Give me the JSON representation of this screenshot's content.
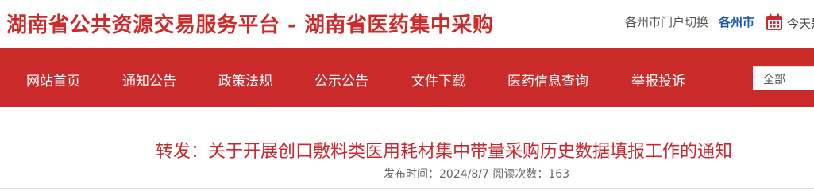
{
  "header": {
    "site_title": "湖南省公共资源交易服务平台 - 湖南省医药集中采购",
    "portal_switch": "各州市门户切换",
    "city_link": "各州市",
    "today_label": "今天是"
  },
  "nav": {
    "items": [
      {
        "label": "网站首页"
      },
      {
        "label": "通知公告"
      },
      {
        "label": "政策法规"
      },
      {
        "label": "公示公告"
      },
      {
        "label": "文件下载"
      },
      {
        "label": "医药信息查询"
      },
      {
        "label": "举报投诉"
      }
    ],
    "search_scope": "全部"
  },
  "article": {
    "title": "转发：关于开展创口敷料类医用耗材集中带量采购历史数据填报工作的通知",
    "meta": "发布时间：2024/8/7 阅读次数：163"
  },
  "colors": {
    "brand_red": "#cb2a2a",
    "title_red": "#c8272d",
    "link_blue": "#1f57a8"
  },
  "icons": {
    "calendar": "calendar-icon"
  }
}
